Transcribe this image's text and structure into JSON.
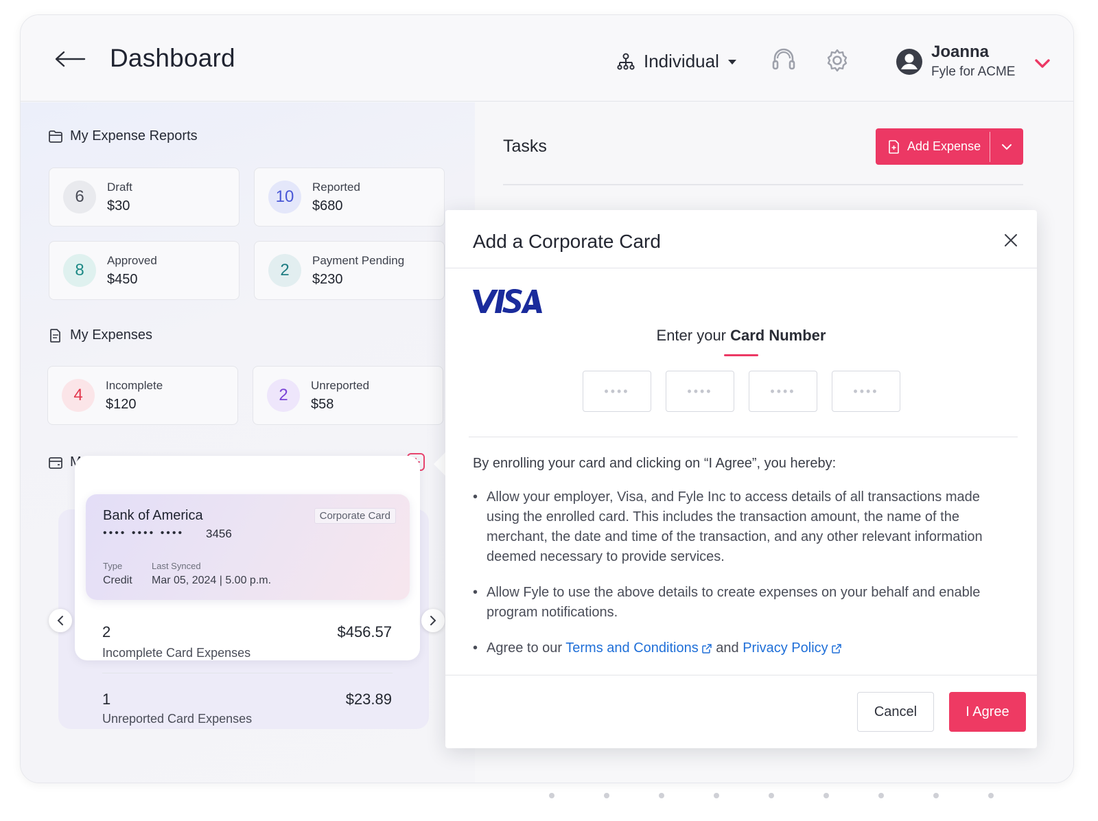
{
  "header": {
    "title": "Dashboard",
    "view_selector": "Individual",
    "user_name": "Joanna",
    "user_org": "Fyle for ACME"
  },
  "reports": {
    "title": "My Expense Reports",
    "items": [
      {
        "count": "6",
        "label": "Draft",
        "amount": "$30",
        "color": "#4a4d58",
        "bg": "#e9eaee"
      },
      {
        "count": "10",
        "label": "Reported",
        "amount": "$680",
        "color": "#4a58d6",
        "bg": "#e4e7fa"
      },
      {
        "count": "8",
        "label": "Approved",
        "amount": "$450",
        "color": "#1e8a86",
        "bg": "#dff1ef"
      },
      {
        "count": "2",
        "label": "Payment Pending",
        "amount": "$230",
        "color": "#1e7c82",
        "bg": "#e2eef0"
      }
    ]
  },
  "expenses": {
    "title": "My Expenses",
    "items": [
      {
        "count": "4",
        "label": "Incomplete",
        "amount": "$120",
        "color": "#e2374d",
        "bg": "#fbe5e8"
      },
      {
        "count": "2",
        "label": "Unreported",
        "amount": "$58",
        "color": "#7a44d6",
        "bg": "#eee6fb"
      }
    ]
  },
  "cards": {
    "title": "My Cards",
    "bank": "Bank of America",
    "badge": "Corporate Card",
    "masked": "•••• •••• ••••",
    "last4": "3456",
    "type_label": "Type",
    "type_value": "Credit",
    "synced_label": "Last Synced",
    "synced_value": "Mar 05, 2024 | 5.00 p.m.",
    "rows": [
      {
        "count": "2",
        "label": "Incomplete Card Expenses",
        "amount": "$456.57"
      },
      {
        "count": "1",
        "label": "Unreported Card Expenses",
        "amount": "$23.89"
      }
    ]
  },
  "tasks": {
    "title": "Tasks",
    "add_expense": "Add Expense"
  },
  "modal": {
    "title": "Add a Corporate Card",
    "enter_prefix": "Enter your ",
    "enter_strong": "Card Number",
    "digit_placeholder": "••••",
    "consent_head": "By enrolling your card and clicking on “I Agree”, you hereby:",
    "bullet1": "Allow your employer, Visa, and Fyle Inc to access details of all transactions made using the enrolled card. This includes the transaction amount, the name of the merchant, the date and time of the transaction, and any other relevant information deemed necessary to provide services.",
    "bullet2": "Allow Fyle to use the above details to create expenses on your behalf and enable program notifications.",
    "bullet3_prefix": "Agree to our ",
    "terms_link": "Terms and Conditions",
    "bullet3_mid": " and ",
    "privacy_link": "Privacy Policy",
    "cancel": "Cancel",
    "agree": "I Agree"
  },
  "colors": {
    "accent": "#ec3864",
    "link": "#1f6fd8",
    "visa": "#1a2b9c"
  }
}
